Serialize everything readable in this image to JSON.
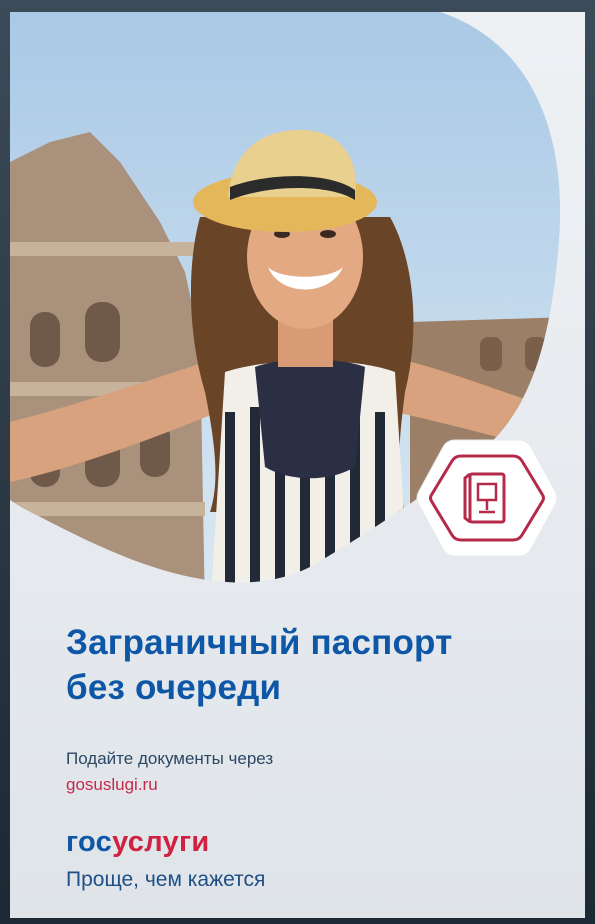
{
  "headline": {
    "line1": "Заграничный паспорт",
    "line2": "без очереди"
  },
  "subtext": {
    "line1": "Подайте документы через",
    "link": "gosuslugi.ru"
  },
  "brand": {
    "part1": "гос",
    "part2": "услуги"
  },
  "tagline": "Проще, чем кажется",
  "colors": {
    "headline_blue": "#0d57a6",
    "accent_red": "#c42a4a",
    "background": "#e8ecf0"
  },
  "icons": {
    "badge": "passport-icon"
  }
}
